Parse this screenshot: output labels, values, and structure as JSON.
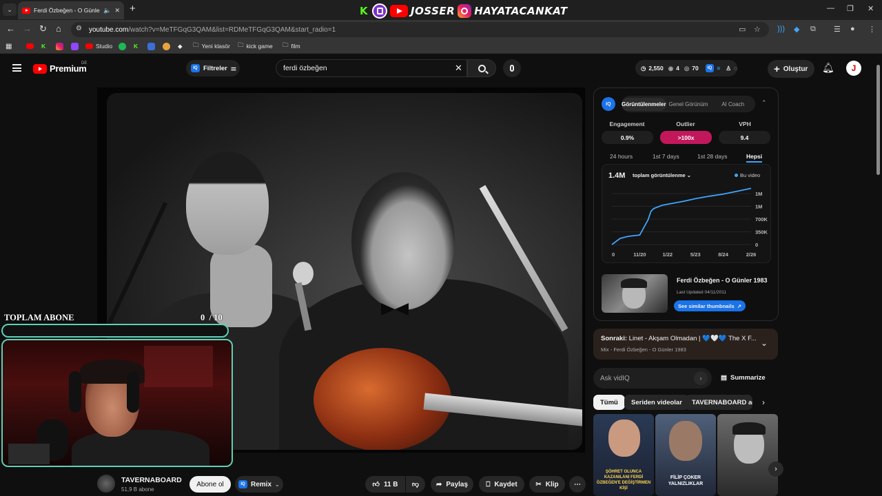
{
  "browser": {
    "tab_title": "Ferdi Özbeğen - O Günler",
    "url_domain": "youtube.com",
    "url_path": "/watch?v=MeTFGqG3QAM&list=RDMeTFGqG3QAM&start_radio=1",
    "banner_text_1": "JOSSER",
    "banner_text_2": "HAYATACANKAT",
    "bookmarks": [
      "Studio",
      "Yeni klasör",
      "kick game",
      "film"
    ]
  },
  "header": {
    "logo": "Premium",
    "country": "DE",
    "filters_label": "Filtreler",
    "search_value": "ferdi özbeğen",
    "stats": {
      "views": "2,550",
      "eye": "4",
      "score": "70"
    },
    "create_label": "Oluştur",
    "avatar_letter": "J"
  },
  "overlay": {
    "title": "TOPLAM ABONE",
    "count": "0",
    "goal": "/ 10",
    "progress": 0.0
  },
  "channel": {
    "name": "TAVERNABOARD",
    "subs": "51,9 B abone",
    "subscribe": "Abone ol",
    "remix": "Remix",
    "likes": "11 B",
    "share": "Paylaş",
    "save": "Kaydet",
    "clip": "Klip"
  },
  "vidiq": {
    "tabs": [
      "Görüntülenmeler",
      "Genel Görünüm",
      "AI Coach"
    ],
    "stats": [
      {
        "label": "Engagement",
        "value": "0.9%"
      },
      {
        "label": "Outlier",
        "value": ">100x"
      },
      {
        "label": "VPH",
        "value": "9.4"
      }
    ],
    "periods": [
      "24 hours",
      "1st 7 days",
      "1st 28 days",
      "Hepsi"
    ],
    "total": "1.4M",
    "metric": "toplam görüntülenme",
    "legend": "Bu video",
    "thumb_title": "Ferdi Özbeğen - O Günler 1983",
    "last_updated": "Last Updated 04/11/2011",
    "similar_btn": "See similar thumbnails"
  },
  "chart_data": {
    "type": "line",
    "title": "",
    "xlabel": "",
    "ylabel": "",
    "x_ticks": [
      "0",
      "11/20",
      "1/22",
      "5/23",
      "8/24",
      "2/26"
    ],
    "y_ticks": [
      "0",
      "350K",
      "700K",
      "1M",
      "1M"
    ],
    "series": [
      {
        "name": "Bu video",
        "x": [
          0,
          0.3,
          0.6,
          1.0,
          1.3,
          1.4,
          1.5,
          1.8,
          2.2,
          2.6,
          3.0,
          3.5,
          4.0,
          4.5,
          5.0
        ],
        "values": [
          0,
          150000,
          200000,
          230000,
          600000,
          800000,
          870000,
          950000,
          1000000,
          1050000,
          1110000,
          1170000,
          1220000,
          1290000,
          1360000
        ]
      }
    ],
    "ylim": [
      0,
      1400000
    ],
    "grid": true
  },
  "next": {
    "label": "Sonraki:",
    "title": "Linet - Akşam Olmadan | 💙🤍💙 The X F...",
    "sub": "Mix - Ferdi Özbeğen - O Günler 1983"
  },
  "ask": {
    "placeholder": "Ask vidIQ",
    "summarize": "Summarize"
  },
  "chips": [
    "Tümü",
    "Seriden videolar",
    "TAVERNABOARD adlı"
  ],
  "thumbs": [
    {
      "caption": "ŞÖHRET OLUNCA KAZANILANI FERDİ ÖZBEĞEN'E DEĞİŞTİRMEN KİŞİ"
    },
    {
      "caption": "FİLİP ÇOKER YALNIZLIKLAR"
    },
    {
      "caption": ""
    }
  ]
}
